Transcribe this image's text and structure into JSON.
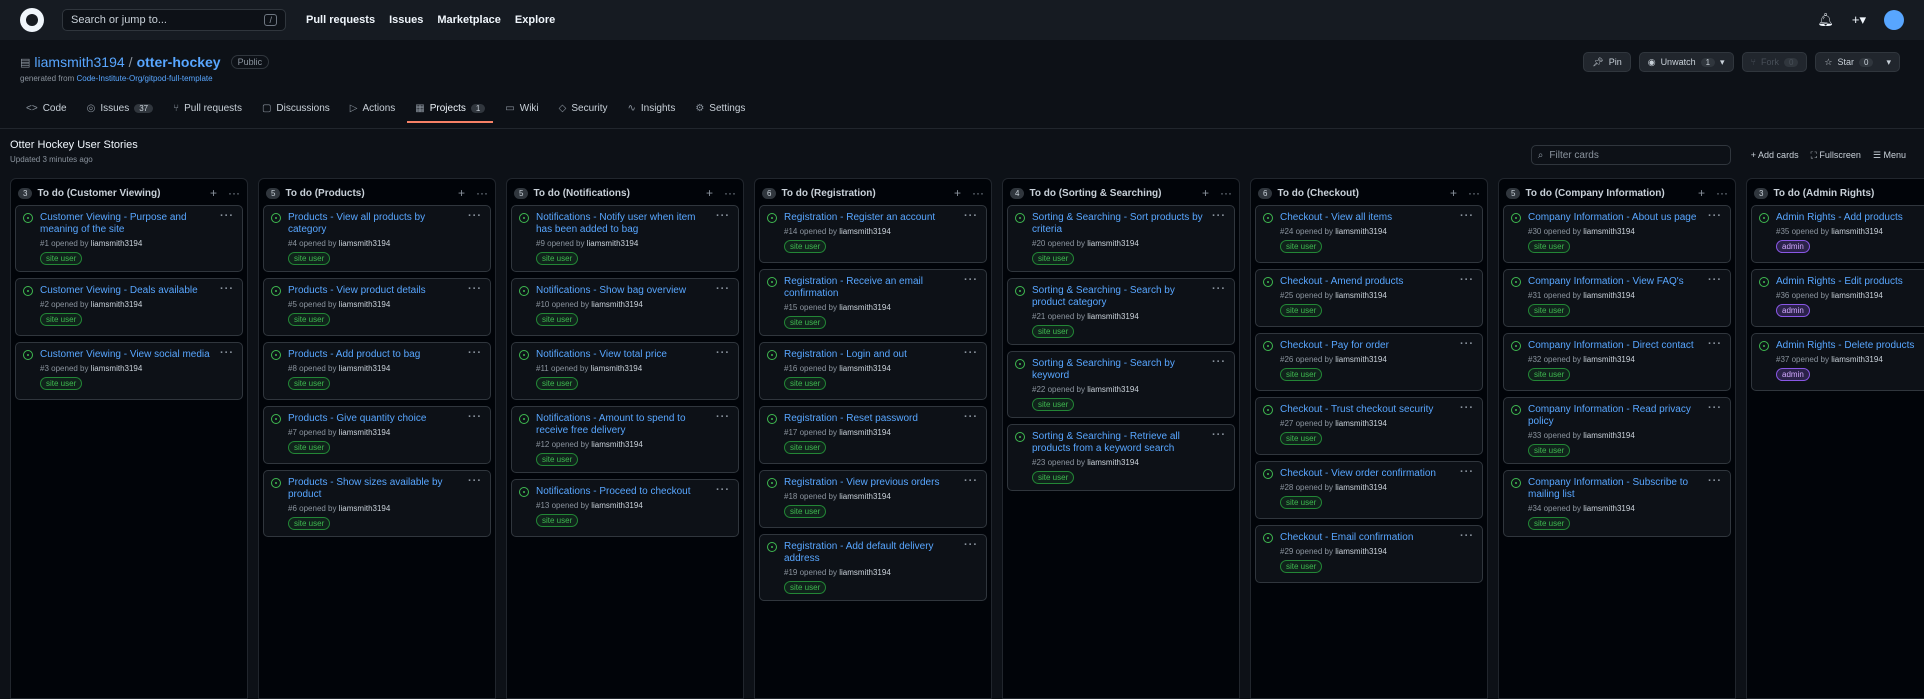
{
  "header": {
    "search_placeholder": "Search or jump to...",
    "search_key": "/",
    "nav": [
      "Pull requests",
      "Issues",
      "Marketplace",
      "Explore"
    ],
    "icons": [
      "bell-icon",
      "plus-icon",
      "avatar"
    ]
  },
  "repo": {
    "owner": "liamsmith3194",
    "separator": "/",
    "name": "otter-hockey",
    "visibility": "Public",
    "generated_prefix": "generated from",
    "generated_from": "Code-Institute-Org/gitpod-full-template",
    "pin": "Pin",
    "unwatch": "Unwatch",
    "unwatch_count": "1",
    "fork": "Fork",
    "fork_count": "0",
    "star": "Star",
    "star_count": "0"
  },
  "tabs": [
    {
      "label": "Code",
      "icon": "<>",
      "count": ""
    },
    {
      "label": "Issues",
      "icon": "◎",
      "count": "37"
    },
    {
      "label": "Pull requests",
      "icon": "⑂",
      "count": ""
    },
    {
      "label": "Discussions",
      "icon": "▢",
      "count": ""
    },
    {
      "label": "Actions",
      "icon": "▷",
      "count": ""
    },
    {
      "label": "Projects",
      "icon": "▦",
      "count": "1"
    },
    {
      "label": "Wiki",
      "icon": "▭",
      "count": ""
    },
    {
      "label": "Security",
      "icon": "◇",
      "count": ""
    },
    {
      "label": "Insights",
      "icon": "∿",
      "count": ""
    },
    {
      "label": "Settings",
      "icon": "⚙",
      "count": ""
    }
  ],
  "project": {
    "title": "Otter Hockey User Stories",
    "updated": "Updated 3 minutes ago",
    "filter_placeholder": "Filter cards",
    "add_cards": "Add cards",
    "fullscreen": "Fullscreen",
    "menu": "Menu"
  },
  "columns": [
    {
      "count": "3",
      "title": "To do (Customer Viewing)",
      "cards": [
        {
          "title": "Customer Viewing - Purpose and meaning of the site",
          "num": "#1",
          "user": "liamsmith3194",
          "label": "site user"
        },
        {
          "title": "Customer Viewing - Deals available",
          "num": "#2",
          "user": "liamsmith3194",
          "label": "site user"
        },
        {
          "title": "Customer Viewing - View social media",
          "num": "#3",
          "user": "liamsmith3194",
          "label": "site user"
        }
      ]
    },
    {
      "count": "5",
      "title": "To do (Products)",
      "cards": [
        {
          "title": "Products - View all products by category",
          "num": "#4",
          "user": "liamsmith3194",
          "label": "site user"
        },
        {
          "title": "Products - View product details",
          "num": "#5",
          "user": "liamsmith3194",
          "label": "site user"
        },
        {
          "title": "Products - Add product to bag",
          "num": "#8",
          "user": "liamsmith3194",
          "label": "site user"
        },
        {
          "title": "Products - Give quantity choice",
          "num": "#7",
          "user": "liamsmith3194",
          "label": "site user"
        },
        {
          "title": "Products - Show sizes available by product",
          "num": "#6",
          "user": "liamsmith3194",
          "label": "site user"
        }
      ]
    },
    {
      "count": "5",
      "title": "To do (Notifications)",
      "cards": [
        {
          "title": "Notifications - Notify user when item has been added to bag",
          "num": "#9",
          "user": "liamsmith3194",
          "label": "site user"
        },
        {
          "title": "Notifications - Show bag overview",
          "num": "#10",
          "user": "liamsmith3194",
          "label": "site user"
        },
        {
          "title": "Notifications - View total price",
          "num": "#11",
          "user": "liamsmith3194",
          "label": "site user"
        },
        {
          "title": "Notifications - Amount to spend to receive free delivery",
          "num": "#12",
          "user": "liamsmith3194",
          "label": "site user"
        },
        {
          "title": "Notifications - Proceed to checkout",
          "num": "#13",
          "user": "liamsmith3194",
          "label": "site user"
        }
      ]
    },
    {
      "count": "6",
      "title": "To do (Registration)",
      "cards": [
        {
          "title": "Registration - Register an account",
          "num": "#14",
          "user": "liamsmith3194",
          "label": "site user"
        },
        {
          "title": "Registration - Receive an email confirmation",
          "num": "#15",
          "user": "liamsmith3194",
          "label": "site user"
        },
        {
          "title": "Registration - Login and out",
          "num": "#16",
          "user": "liamsmith3194",
          "label": "site user"
        },
        {
          "title": "Registration - Reset password",
          "num": "#17",
          "user": "liamsmith3194",
          "label": "site user"
        },
        {
          "title": "Registration - View previous orders",
          "num": "#18",
          "user": "liamsmith3194",
          "label": "site user"
        },
        {
          "title": "Registration - Add default delivery address",
          "num": "#19",
          "user": "liamsmith3194",
          "label": "site user"
        }
      ]
    },
    {
      "count": "4",
      "title": "To do (Sorting & Searching)",
      "cards": [
        {
          "title": "Sorting & Searching - Sort products by criteria",
          "num": "#20",
          "user": "liamsmith3194",
          "label": "site user"
        },
        {
          "title": "Sorting & Searching - Search by product category",
          "num": "#21",
          "user": "liamsmith3194",
          "label": "site user"
        },
        {
          "title": "Sorting & Searching - Search by keyword",
          "num": "#22",
          "user": "liamsmith3194",
          "label": "site user"
        },
        {
          "title": "Sorting & Searching - Retrieve all products from a keyword search",
          "num": "#23",
          "user": "liamsmith3194",
          "label": "site user"
        }
      ]
    },
    {
      "count": "6",
      "title": "To do (Checkout)",
      "cards": [
        {
          "title": "Checkout - View all items",
          "num": "#24",
          "user": "liamsmith3194",
          "label": "site user"
        },
        {
          "title": "Checkout - Amend products",
          "num": "#25",
          "user": "liamsmith3194",
          "label": "site user"
        },
        {
          "title": "Checkout - Pay for order",
          "num": "#26",
          "user": "liamsmith3194",
          "label": "site user"
        },
        {
          "title": "Checkout - Trust checkout security",
          "num": "#27",
          "user": "liamsmith3194",
          "label": "site user"
        },
        {
          "title": "Checkout - View order confirmation",
          "num": "#28",
          "user": "liamsmith3194",
          "label": "site user"
        },
        {
          "title": "Checkout - Email confirmation",
          "num": "#29",
          "user": "liamsmith3194",
          "label": "site user"
        }
      ]
    },
    {
      "count": "5",
      "title": "To do (Company Information)",
      "cards": [
        {
          "title": "Company Information - About us page",
          "num": "#30",
          "user": "liamsmith3194",
          "label": "site user"
        },
        {
          "title": "Company Information - View FAQ's",
          "num": "#31",
          "user": "liamsmith3194",
          "label": "site user"
        },
        {
          "title": "Company Information - Direct contact",
          "num": "#32",
          "user": "liamsmith3194",
          "label": "site user"
        },
        {
          "title": "Company Information - Read privacy policy",
          "num": "#33",
          "user": "liamsmith3194",
          "label": "site user"
        },
        {
          "title": "Company Information - Subscribe to mailing list",
          "num": "#34",
          "user": "liamsmith3194",
          "label": "site user"
        }
      ]
    },
    {
      "count": "3",
      "title": "To do (Admin Rights)",
      "cards": [
        {
          "title": "Admin Rights - Add products",
          "num": "#35",
          "user": "liamsmith3194",
          "label": "admin"
        },
        {
          "title": "Admin Rights - Edit products",
          "num": "#36",
          "user": "liamsmith3194",
          "label": "admin"
        },
        {
          "title": "Admin Rights - Delete products",
          "num": "#37",
          "user": "liamsmith3194",
          "label": "admin"
        }
      ]
    }
  ],
  "card_meta_text": "opened by",
  "colors": {
    "accent": "#58a6ff",
    "site_user_label": "#3fb950",
    "admin_label": "#d2a8ff",
    "active_tab": "#f78166"
  }
}
